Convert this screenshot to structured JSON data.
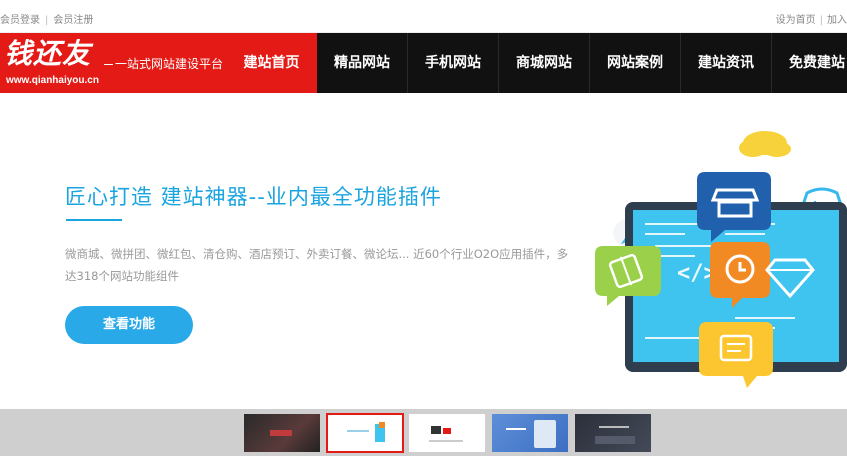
{
  "topbar": {
    "member_login": "会员登录",
    "member_register": "会员注册",
    "set_homepage": "设为首页",
    "add_favorite": "加入"
  },
  "logo": {
    "brand": "钱还友",
    "domain": "www.qianhaiyou.cn",
    "slogan": "一站式网站建设平台"
  },
  "nav": {
    "items": [
      {
        "label": "建站首页"
      },
      {
        "label": "精品网站"
      },
      {
        "label": "手机网站"
      },
      {
        "label": "商城网站"
      },
      {
        "label": "网站案例"
      },
      {
        "label": "建站资讯"
      },
      {
        "label": "免费建站"
      }
    ],
    "active_index": 0
  },
  "hero": {
    "title": "匠心打造 建站神器--业内最全功能插件",
    "description": "微商城、微拼团、微红包、清仓购、酒店预订、外卖订餐、微论坛... 近60个行业O2O应用插件，多达318个网站功能组件",
    "button": "查看功能",
    "code_text": "</>"
  },
  "thumbnails": {
    "count": 5,
    "active_index": 1
  },
  "colors": {
    "brand_red": "#e31a16",
    "nav_bg": "#111111",
    "accent_blue": "#1aa4e0",
    "button_blue": "#2aa9e8",
    "strip_bg": "#cfcfcf"
  }
}
